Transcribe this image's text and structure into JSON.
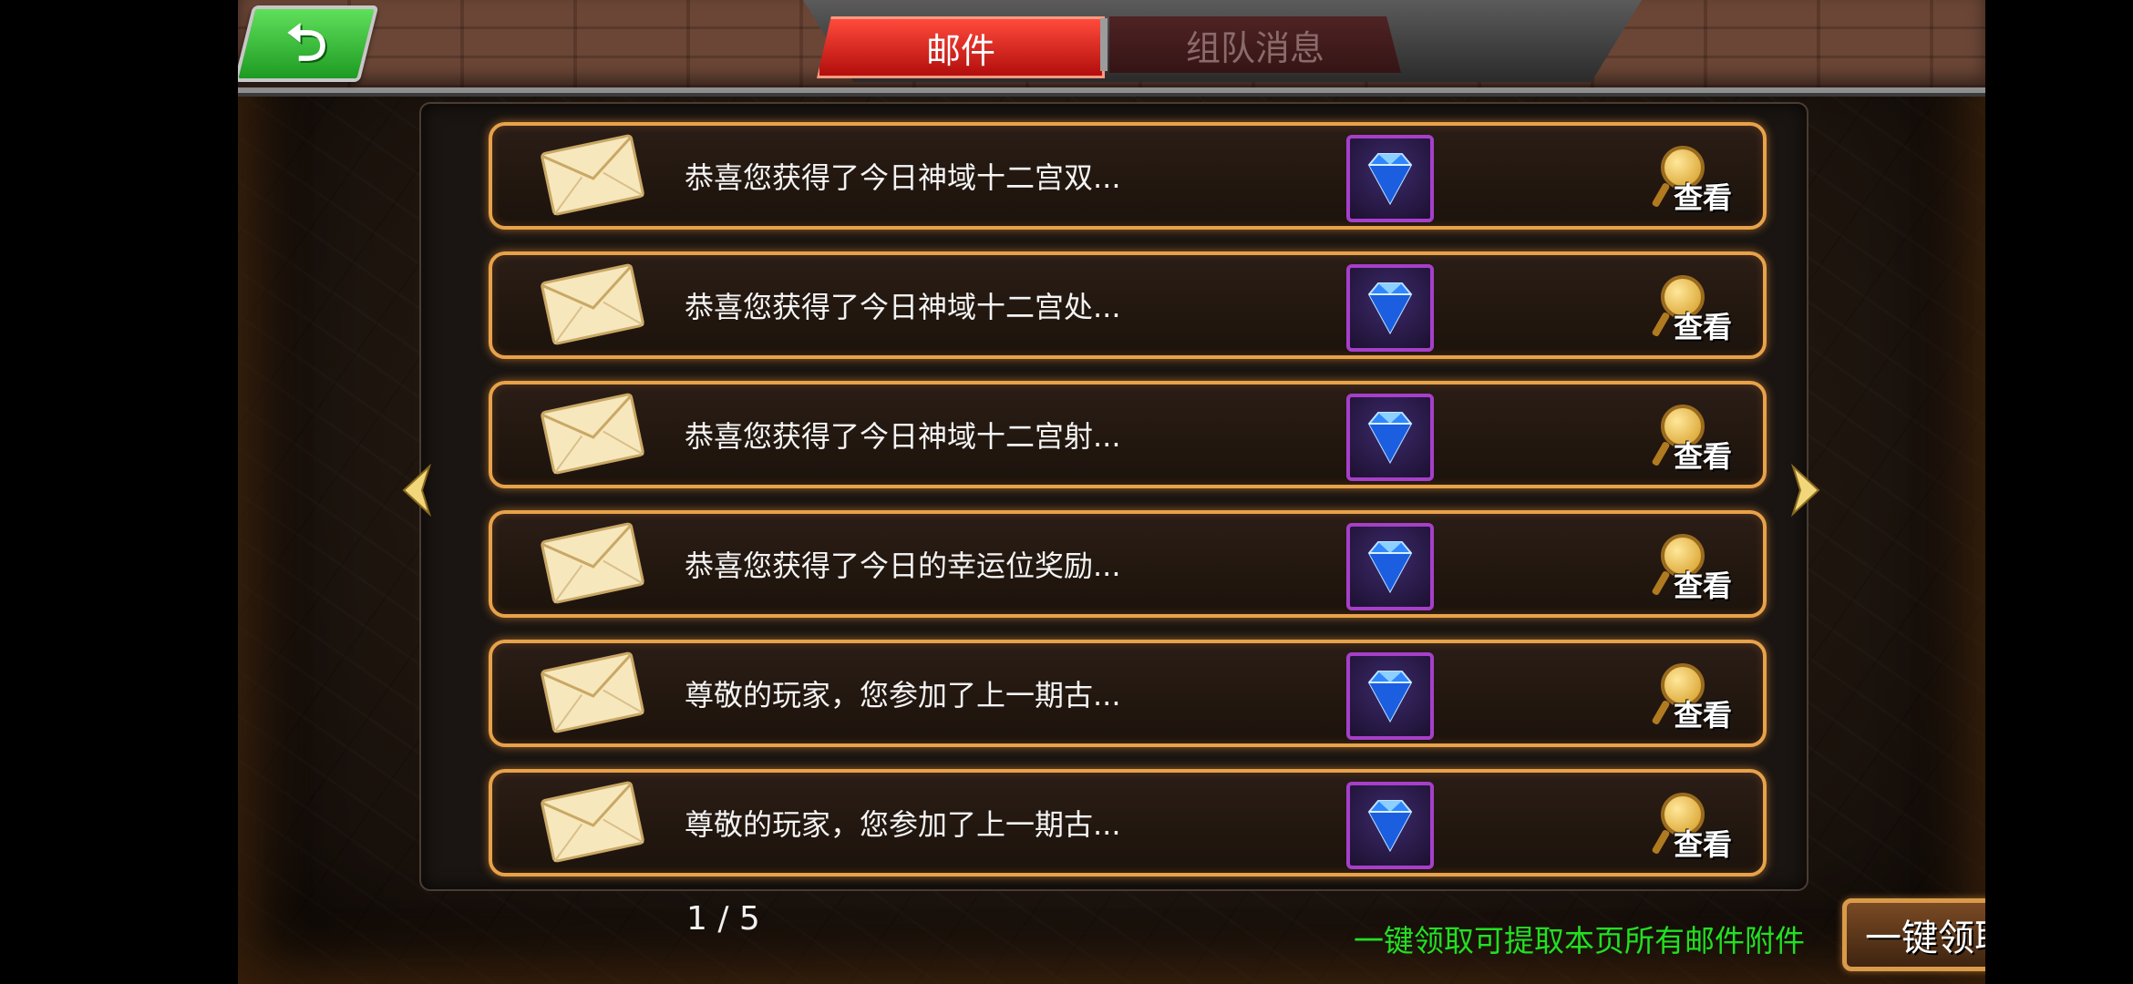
{
  "header": {
    "back_icon": "back-arrow-icon",
    "tabs": [
      {
        "label": "邮件",
        "active": true
      },
      {
        "label": "组队消息",
        "active": false
      }
    ]
  },
  "mail_list": [
    {
      "text": "恭喜您获得了今日神域十二宫双...",
      "view_label": "查看"
    },
    {
      "text": "恭喜您获得了今日神域十二宫处...",
      "view_label": "查看"
    },
    {
      "text": "恭喜您获得了今日神域十二宫射...",
      "view_label": "查看"
    },
    {
      "text": "恭喜您获得了今日的幸运位奖励...",
      "view_label": "查看"
    },
    {
      "text": "尊敬的玩家，您参加了上一期古...",
      "view_label": "查看"
    },
    {
      "text": "尊敬的玩家，您参加了上一期古...",
      "view_label": "查看"
    }
  ],
  "pagination": {
    "current": 1,
    "total": 5,
    "display": "1 / 5"
  },
  "footer": {
    "hint": "一键领取可提取本页所有邮件附件",
    "claim_all_label": "一键领取"
  },
  "colors": {
    "active_tab": "#d7201c",
    "row_border": "#e8a24a",
    "gem_border": "#a63fc9",
    "hint_text": "#22e022"
  }
}
